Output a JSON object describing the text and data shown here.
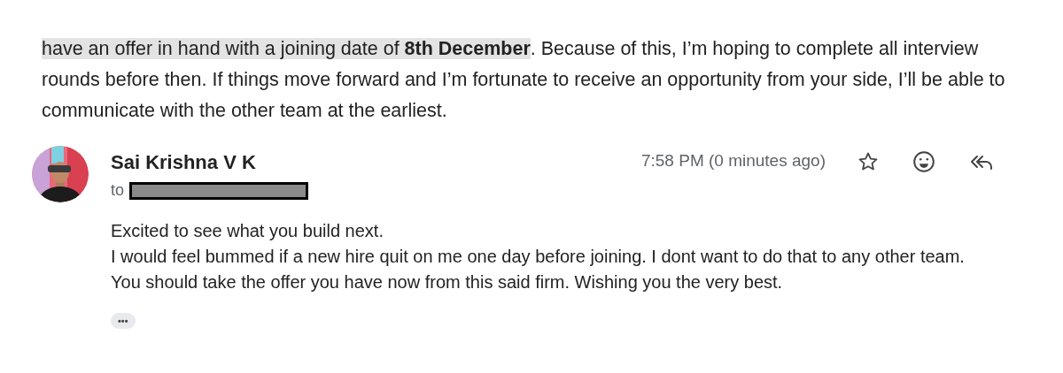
{
  "quoted_message": {
    "lines": [
      {
        "highlighted": "have an offer in hand with a joining date of **8th December**",
        "text": ". Because of this, I’m hoping to complete all interview"
      },
      {
        "text": "rounds before then. If things move forward and I’m fortunate to receive an opportunity from your side, I’ll be able to"
      },
      {
        "text": "communicate with the other team at the earliest."
      }
    ]
  },
  "message": {
    "sender": "Sai Krishna V K",
    "to_label": "to",
    "recipient_redacted": true,
    "time": "7:58 PM (0 minutes ago)",
    "starred": false,
    "body": [
      "Excited to see what you build next.",
      "I would feel bummed if a new hire quit on me one day before joining. I dont want to do that to any other team.",
      "You should take the offer you have now from this said firm. Wishing you the very best."
    ],
    "more_label": "•••"
  }
}
